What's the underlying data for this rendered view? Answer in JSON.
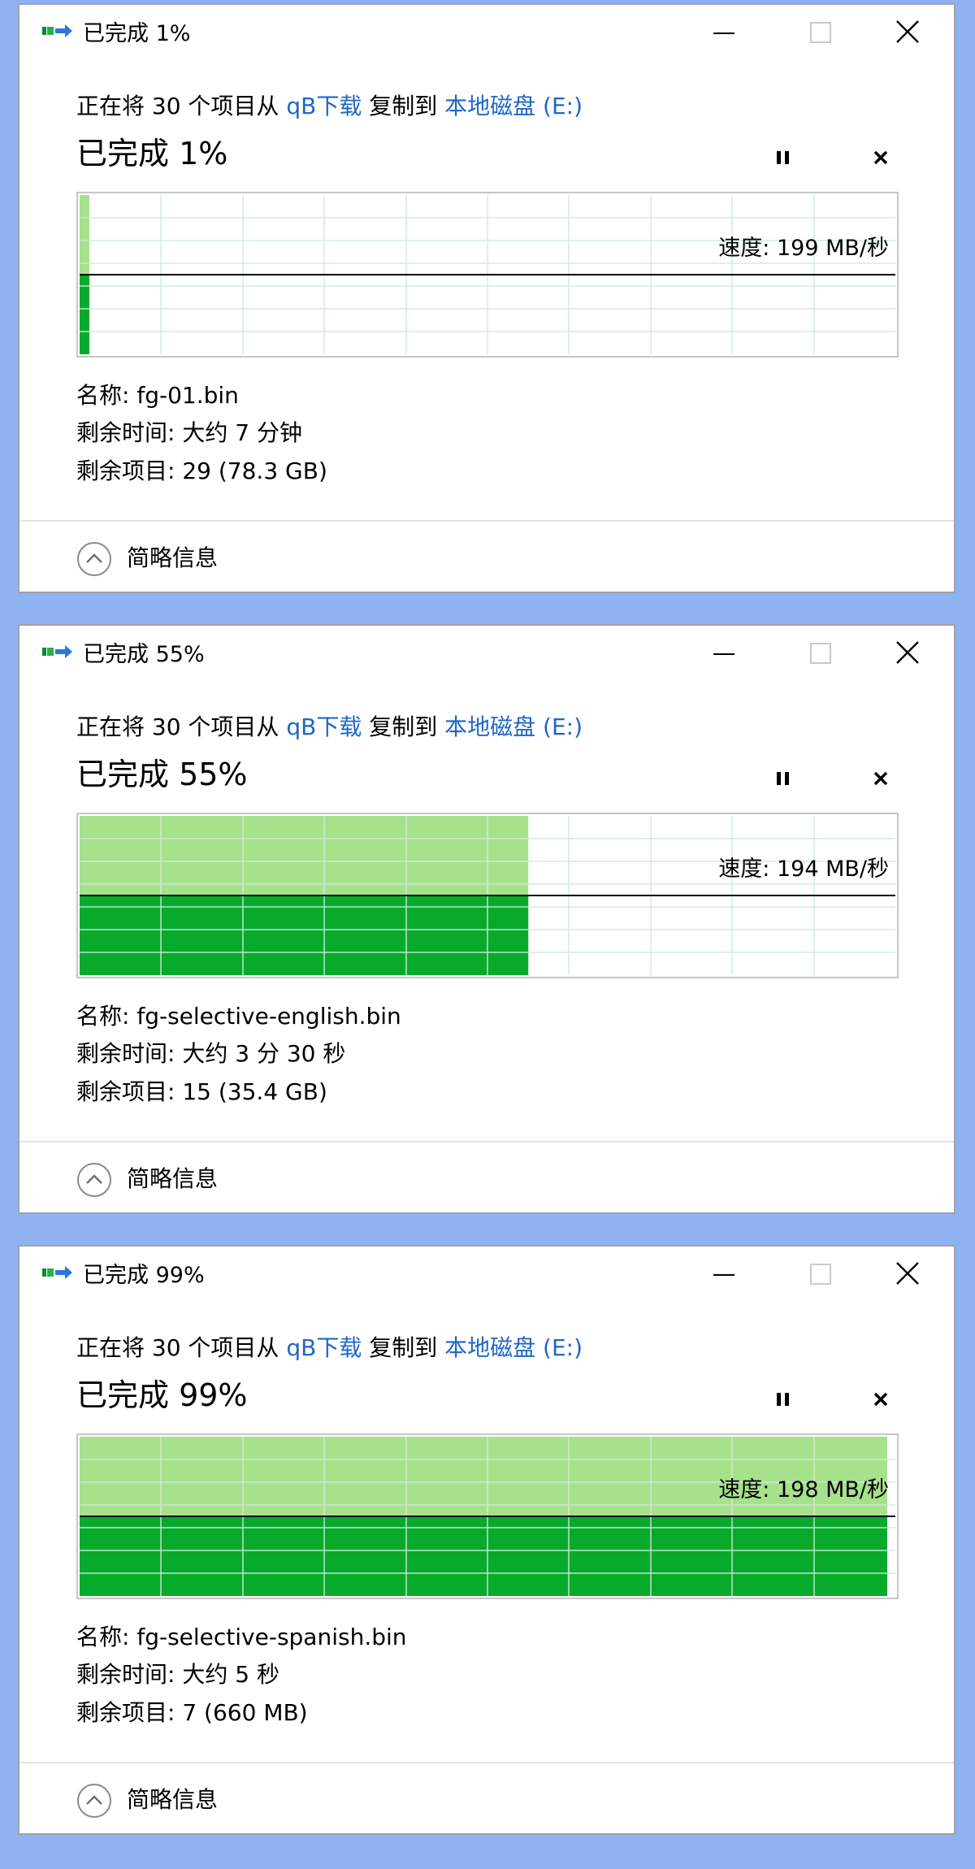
{
  "colors": {
    "background": "#8eb2f2",
    "link": "#1f66c6",
    "progress_done": "#08aa2c",
    "progress_light": "#a6e28c",
    "grid": "#cfead7"
  },
  "icons": {
    "app": "copy-transfer-icon",
    "minimize": "minimize-icon",
    "maximize": "maximize-icon",
    "close": "close-icon",
    "pause": "pause-icon",
    "cancel": "cancel-icon",
    "collapse": "chevron-up-circle-icon"
  },
  "dialogs": [
    {
      "title": "已完成 1%",
      "desc_prefix": "正在将 30 个项目从",
      "source": "qB下载",
      "desc_middle": "复制到",
      "destination": "本地磁盘 (E:)",
      "progress_text": "已完成 1%",
      "progress": 0.01,
      "speed_text": "速度: 199 MB/秒",
      "name_text": "名称: fg-01.bin",
      "time_text": "剩余时间: 大约 7 分钟",
      "items_text": "剩余项目: 29 (78.3 GB)",
      "details_label": "简略信息"
    },
    {
      "title": "已完成 55%",
      "desc_prefix": "正在将 30 个项目从",
      "source": "qB下载",
      "desc_middle": "复制到",
      "destination": "本地磁盘 (E:)",
      "progress_text": "已完成 55%",
      "progress": 0.55,
      "speed_text": "速度: 194 MB/秒",
      "name_text": "名称: fg-selective-english.bin",
      "time_text": "剩余时间: 大约 3 分 30 秒",
      "items_text": "剩余项目: 15 (35.4 GB)",
      "details_label": "简略信息"
    },
    {
      "title": "已完成 99%",
      "desc_prefix": "正在将 30 个项目从",
      "source": "qB下载",
      "desc_middle": "复制到",
      "destination": "本地磁盘 (E:)",
      "progress_text": "已完成 99%",
      "progress": 0.99,
      "speed_text": "速度: 198 MB/秒",
      "name_text": "名称: fg-selective-spanish.bin",
      "time_text": "剩余时间: 大约 5 秒",
      "items_text": "剩余项目: 7 (660 MB)",
      "details_label": "简略信息"
    }
  ]
}
